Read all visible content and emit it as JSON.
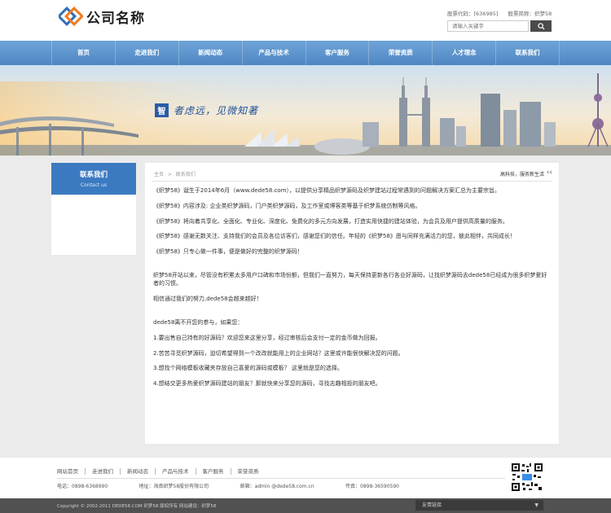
{
  "header": {
    "logo_text": "公司名称",
    "stock_code": "股票代码：[636985]",
    "stock_name": "股票简称：织梦58",
    "search_placeholder": "请输入关键字"
  },
  "nav": {
    "items": [
      "首页",
      "走进我们",
      "新闻动态",
      "产品与技术",
      "客户服务",
      "荣誉资质",
      "人才理念",
      "联系我们"
    ]
  },
  "banner": {
    "slogan_mark": "智",
    "slogan": "者虑远，见微知著"
  },
  "sidebar": {
    "title": "联系我们",
    "subtitle": "Contact us"
  },
  "breadcrumb": {
    "home": "主页",
    "separator": ">",
    "current": "联系我们",
    "right": "高科技，服务新生活",
    "arrow": "‹‹"
  },
  "article": {
    "paragraphs": [
      "《织梦58》诞生于2014年6月（www.dede58.com），以提供分享精品织梦源码及织梦建站过程常遇到的问题解决方案汇总为主要宗旨。",
      "《织梦58》内容涉及: 企业类织梦源码，门户类织梦源码，及工作室或博客类等基于织梦系统仿制等风格。",
      "《织梦58》将向着共享化、全面化、专业化、深度化、免费化的多元方向发展，打造实用快捷的建站体验，为会员及用户提供高质量的服务。",
      "《织梦58》感谢无数关注、支持我们的会员及各位访客们，感谢您们的信任。年轻的《织梦58》愿与同样充满活力的您，彼此相伴，共同成长！",
      "《织梦58》只专心做一件事，便是做好的完整的织梦源码！",
      "织梦58开站以来，尽管没有积累太多用户口碑和市场份额，但我们一直努力，每天保持更新各行各业好源码，让找织梦源码去dede58已经成为很多织梦爱好者的习惯。",
      "相信通过我们的努力,dede58会越来越好！",
      "dede58离不开您的参与，如果您：",
      "1.要出售自己持有的好源码？欢迎您来这里分享，经过审核后会支付一定的金币做为回报。",
      "2.苦苦寻觅织梦源码，迫切希望得到一个改改就能用上的企业网站？这里或许能很快解决您的问题。",
      "3.想找个网络模板收藏夹存放自己喜爱的源码或模板？ 这里就是您的选择。",
      "4.想结交更多热爱织梦源码建站的朋友？那就快来分享您的源码，寻找志趣相投的朋友吧。"
    ]
  },
  "footer": {
    "links": [
      "网站首页",
      "走进我们",
      "新闻动态",
      "产品与技术",
      "客户服务",
      "荣誉资质"
    ],
    "phone": "电话：0898-6368990",
    "address": "地址：海南织梦58股份有限公司",
    "email": "邮箱：admin @dede58.com.cn",
    "fax": "传真：0898-36590590",
    "copyright": "Copyright © 2002-2011 DEDE58.COM 织梦58 版权所有  网站建设：织梦58",
    "friend_links": "友情链接"
  },
  "colors": {
    "nav_blue": "#5a92cc",
    "sidebar_blue": "#3b7ac1",
    "band_grey": "#ebebeb",
    "footer_dark": "#515151"
  }
}
